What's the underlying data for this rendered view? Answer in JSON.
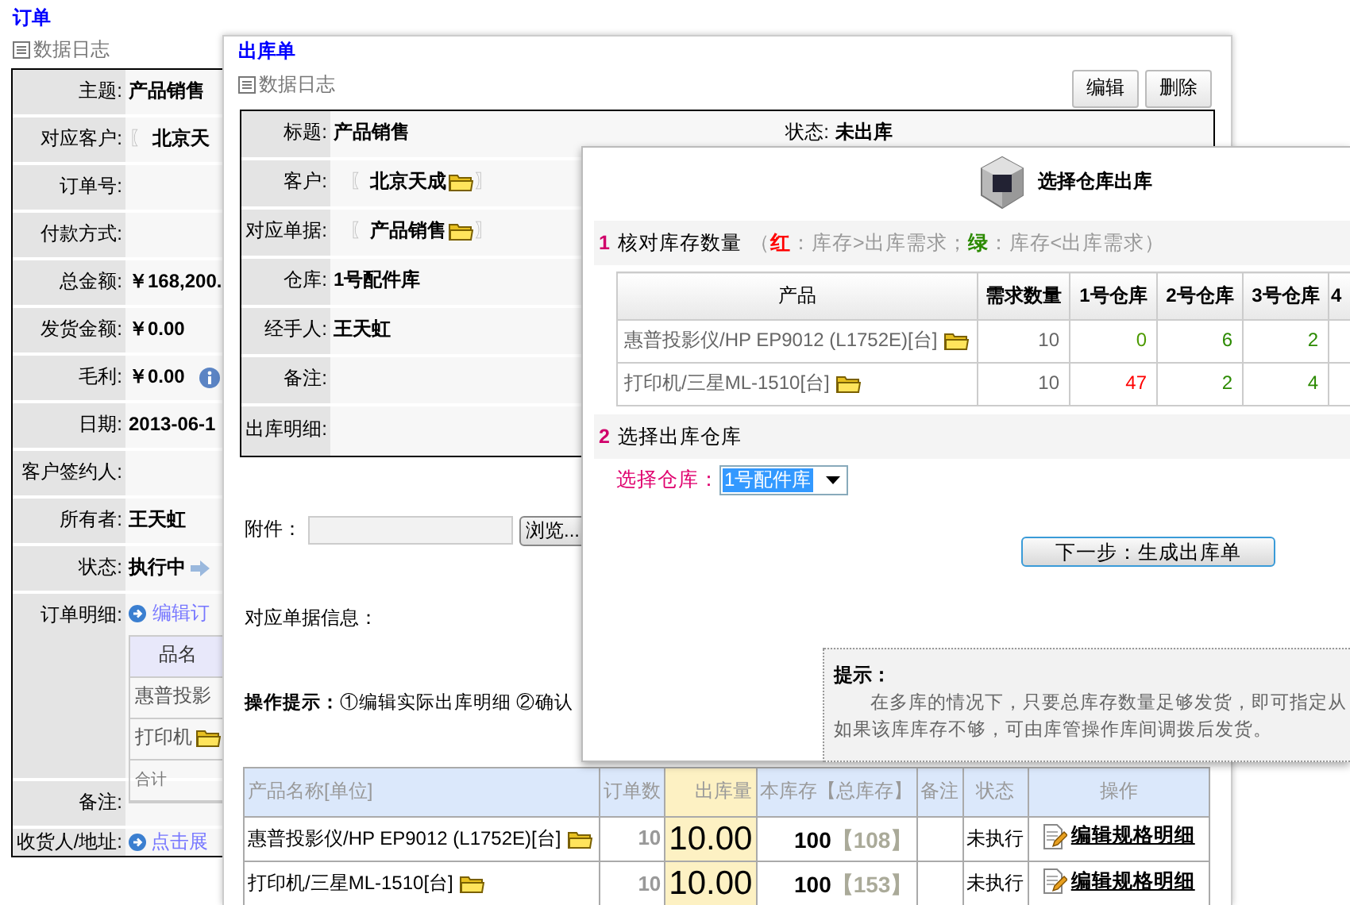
{
  "order": {
    "title": "订单",
    "log": "数据日志",
    "fields": [
      {
        "label": "主题:",
        "value": "产品销售",
        "kind": "text"
      },
      {
        "label": "对应客户:",
        "prefix": "〖",
        "value": "北京天",
        "kind": "ref"
      },
      {
        "label": "订单号:",
        "kind": "text"
      },
      {
        "label": "付款方式:",
        "kind": "text"
      },
      {
        "label": "总金额:",
        "value": "￥168,200.",
        "kind": "text"
      },
      {
        "label": "发货金额:",
        "value": "￥0.00",
        "kind": "text"
      },
      {
        "label": "毛利:",
        "value": "￥0.00",
        "kind": "info"
      },
      {
        "label": "日期:",
        "value": "2013-06-1",
        "kind": "text"
      },
      {
        "label": "客户签约人:",
        "kind": "text"
      },
      {
        "label": "所有者:",
        "value": "王天虹",
        "kind": "text"
      },
      {
        "label": "状态:",
        "value": "执行中",
        "kind": "arrow"
      },
      {
        "label": "订单明细:",
        "kind": "detail",
        "link": "编辑订",
        "header": "品名",
        "rows": [
          {
            "text": "惠普投影",
            "kind": "plain"
          },
          {
            "text": "打印机",
            "kind": "folder"
          },
          {
            "text": "合计",
            "kind": "total"
          }
        ]
      },
      {
        "label": "备注:",
        "kind": "text"
      },
      {
        "label": "收货人/地址:",
        "kind": "expand",
        "link": "点击展"
      }
    ]
  },
  "stock_out": {
    "title": "出库单",
    "log": "数据日志",
    "buttons": [
      "编辑",
      "删除"
    ],
    "rows": [
      {
        "label": "标题:",
        "value": "产品销售",
        "kind": "text",
        "side_label": "状态:",
        "side_value": "未出库"
      },
      {
        "label": "客户:",
        "prefix": "〖",
        "value": "北京天成",
        "suffix": "〗",
        "kind": "ref"
      },
      {
        "label": "对应单据:",
        "prefix": "〖",
        "value": "产品销售",
        "suffix": "〗",
        "kind": "ref"
      },
      {
        "label": "仓库:",
        "value": "1号配件库",
        "kind": "text"
      },
      {
        "label": "经手人:",
        "value": "王天虹",
        "kind": "text"
      },
      {
        "label": "备注:",
        "kind": "text"
      },
      {
        "label": "出库明细:",
        "kind": "text"
      }
    ],
    "attachment": {
      "label": "附件：",
      "button": "浏览..."
    },
    "related": "对应单据信息：",
    "hint": {
      "label": "操作提示：",
      "text": "①编辑实际出库明细 ②确认"
    },
    "table": {
      "columns": [
        "产品名称[单位]",
        "订单数",
        "出库量",
        "本库存【总库存】",
        "备注",
        "状态",
        "操作"
      ],
      "rows": [
        {
          "product": "惠普投影仪/HP EP9012 (L1752E)[台]",
          "ordered": "10",
          "out": "10.00",
          "stock": "100",
          "total": "【108】",
          "status": "未执行",
          "action": "编辑规格明细"
        },
        {
          "product": "打印机/三星ML-1510[台]",
          "ordered": "10",
          "out": "10.00",
          "stock": "100",
          "total": "【153】",
          "status": "未执行",
          "action": "编辑规格明细"
        }
      ]
    }
  },
  "warehouse_dialog": {
    "title": "选择仓库出库",
    "step1": {
      "number": "1",
      "title": "核对库存数量",
      "legend": [
        {
          "text": "（"
        },
        {
          "text": "红",
          "color": "#ff0000"
        },
        {
          "text": "：库存>出库需求；"
        },
        {
          "text": "绿",
          "color": "#2b8a00"
        },
        {
          "text": "：库存<出库需求）"
        }
      ]
    },
    "stock_table": {
      "columns": [
        "产品",
        "需求数量",
        "1号仓库",
        "2号仓库",
        "3号仓库",
        "4"
      ],
      "rows": [
        {
          "product": "惠普投影仪/HP EP9012 (L1752E)[台]",
          "demand": "10",
          "stocks": [
            {
              "text": "0",
              "color": "#4c9a00"
            },
            {
              "text": "6",
              "color": "#2b8a00"
            },
            {
              "text": "2",
              "color": "#2b8a00"
            }
          ]
        },
        {
          "product": "打印机/三星ML-1510[台]",
          "demand": "10",
          "stocks": [
            {
              "text": "47",
              "color": "#ff0000"
            },
            {
              "text": "2",
              "color": "#2b8a00"
            },
            {
              "text": "4",
              "color": "#2b8a00"
            }
          ]
        }
      ]
    },
    "step2": {
      "number": "2",
      "title": "选择出库仓库"
    },
    "select": {
      "label": "选择仓库：",
      "value": "1号配件库"
    },
    "next_button": "下一步：生成出库单",
    "tip": {
      "title": "提示：",
      "lines": [
        "在多库的情况下，只要总库存数量足够发货，即可指定从",
        "如果该库库存不够，可由库管操作库间调拨后发货。"
      ]
    }
  }
}
